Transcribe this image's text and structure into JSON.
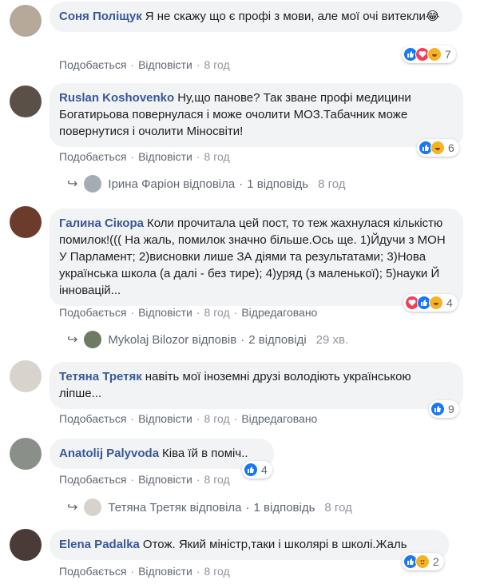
{
  "colors": {
    "link": "#385898",
    "bubble": "#f2f3f5",
    "muted": "#606770",
    "like": "#1877f2",
    "love": "#f33e58",
    "haha": "#f7b125"
  },
  "comments": [
    {
      "author": "Соня Поліщук",
      "text": "Я не скажу що є профі з мови, але мої очі витекли😂",
      "actions": {
        "like": "Подобається",
        "reply": "Відповісти",
        "time": "8 год",
        "edited": ""
      },
      "reactions": {
        "icons": [
          "like-icon",
          "love-icon",
          "haha-icon"
        ],
        "count": "7"
      }
    },
    {
      "author": "Ruslan Koshovenko",
      "text": "Ну,що панове? Так зване профі медицини Богатирьова повернулася і може очолити МОЗ.Табачник може повернутися і очолити Міносвіти!",
      "actions": {
        "like": "Подобається",
        "reply": "Відповісти",
        "time": "8 год",
        "edited": ""
      },
      "reactions": {
        "icons": [
          "like-icon",
          "haha-icon"
        ],
        "count": "6"
      },
      "reply": {
        "name": "Ірина Фаріон відповіла",
        "count": "1 відповідь",
        "time": "8 год"
      }
    },
    {
      "author": "Галина Сікора",
      "text": "Коли прочитала цей пост, то теж жахнулася кількістю помилок!((( На жаль, помилок значно більше.Ось ще. 1)Йдучи з МОН У Парламент; 2)висновки лише ЗА діями та результатами; 3)Нова українська школа (а далі - без тире); 4)уряд (з маленької); 5)науки Й інновацій...",
      "actions": {
        "like": "Подобається",
        "reply": "Відповісти",
        "time": "8 год",
        "edited": "Відредаговано"
      },
      "reactions": {
        "icons": [
          "love-icon",
          "like-icon",
          "haha-icon"
        ],
        "count": "4"
      },
      "reply": {
        "name": "Mykolaj Bilozor відповів",
        "count": "2 відповіді",
        "time": "29 хв."
      }
    },
    {
      "author": "Тетяна Третяк",
      "text": "навіть мої іноземні друзі володіють українською ліпше...",
      "actions": {
        "like": "Подобається",
        "reply": "Відповісти",
        "time": "8 год",
        "edited": "Відредаговано"
      },
      "reactions": {
        "icons": [
          "like-icon"
        ],
        "count": "9"
      }
    },
    {
      "author": "Anatolij Palyvoda",
      "text": "Ківа їй в поміч..",
      "actions": {
        "like": "Подобається",
        "reply": "Відповісти",
        "time": "8 год",
        "edited": ""
      },
      "reactions": {
        "icons": [
          "like-icon"
        ],
        "count": "4"
      },
      "reply": {
        "name": "Тетяна Третяк відповіла",
        "count": "1 відповідь",
        "time": "8 год"
      }
    },
    {
      "author": "Elena Padalka",
      "text": "Отож. Який міністр,таки і школярі в школі.Жаль",
      "actions": {
        "like": "Подобається",
        "reply": "Відповісти",
        "time": "8 год",
        "edited": ""
      },
      "reactions": {
        "icons": [
          "like-icon",
          "sad-icon"
        ],
        "count": "2"
      }
    }
  ]
}
